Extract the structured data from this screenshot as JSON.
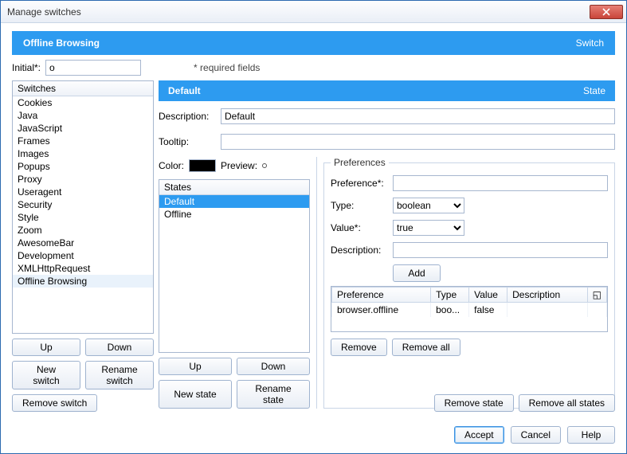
{
  "window": {
    "title": "Manage switches"
  },
  "header": {
    "title": "Offline Browsing",
    "tag": "Switch"
  },
  "initial": {
    "label": "Initial*:",
    "value": "o",
    "hint": "* required fields"
  },
  "switches": {
    "header": "Switches",
    "items": [
      "Cookies",
      "Java",
      "JavaScript",
      "Frames",
      "Images",
      "Popups",
      "Proxy",
      "Useragent",
      "Security",
      "Style",
      "Zoom",
      "AwesomeBar",
      "Development",
      "XMLHttpRequest",
      "Offline Browsing"
    ],
    "selected_index": 14
  },
  "switch_buttons": {
    "up": "Up",
    "down": "Down",
    "new_switch": "New switch",
    "rename_switch": "Rename switch",
    "remove_switch": "Remove switch"
  },
  "state_header": {
    "title": "Default",
    "tag": "State"
  },
  "state_form": {
    "description_label": "Description:",
    "description_value": "Default",
    "tooltip_label": "Tooltip:",
    "tooltip_value": "",
    "color_label": "Color:",
    "preview_label": "Preview:"
  },
  "states": {
    "header": "States",
    "items": [
      "Default",
      "Offline"
    ],
    "selected_index": 0
  },
  "states_buttons": {
    "up": "Up",
    "down": "Down",
    "new_state": "New state",
    "rename_state": "Rename state",
    "remove_state": "Remove state",
    "remove_all_states": "Remove all states"
  },
  "prefs": {
    "group_label": "Preferences",
    "preference_label": "Preference*:",
    "preference_value": "",
    "type_label": "Type:",
    "type_value": "boolean",
    "value_label": "Value*:",
    "value_value": "true",
    "description_label": "Description:",
    "description_value": "",
    "add": "Add",
    "columns": {
      "pref": "Preference",
      "type": "Type",
      "value": "Value",
      "desc": "Description"
    },
    "rows": [
      {
        "pref": "browser.offline",
        "type": "boo...",
        "value": "false",
        "desc": ""
      }
    ],
    "remove": "Remove",
    "remove_all": "Remove all"
  },
  "footer": {
    "accept": "Accept",
    "cancel": "Cancel",
    "help": "Help"
  }
}
